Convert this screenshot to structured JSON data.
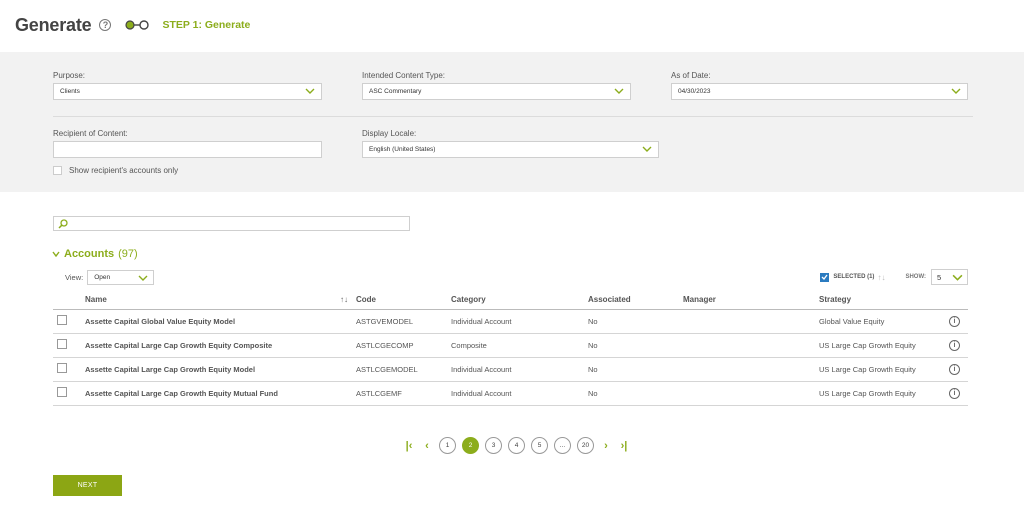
{
  "header": {
    "title": "Generate",
    "help_icon": "?",
    "step_label": "STEP 1: Generate"
  },
  "filters": {
    "purpose": {
      "label": "Purpose:",
      "value": "Clients"
    },
    "content_type": {
      "label": "Intended Content Type:",
      "value": "ASC Commentary"
    },
    "as_of_date": {
      "label": "As of Date:",
      "value": "04/30/2023"
    },
    "recipient": {
      "label": "Recipient of Content:",
      "value": ""
    },
    "locale": {
      "label": "Display Locale:",
      "value": "English (United States)"
    },
    "show_recipient_only": {
      "label": "Show recipient's accounts only",
      "checked": false
    }
  },
  "search": {
    "placeholder": ""
  },
  "accounts": {
    "title": "Accounts",
    "count": "(97)",
    "view_label": "View:",
    "view_value": "Open",
    "selected_label": "SELECTED (1)",
    "show_label": "SHOW:",
    "show_value": "5",
    "columns": {
      "name": "Name",
      "code": "Code",
      "category": "Category",
      "associated": "Associated",
      "manager": "Manager",
      "strategy": "Strategy"
    },
    "rows": [
      {
        "name": "Assette Capital Global Value Equity Model",
        "code": "ASTGVEMODEL",
        "category": "Individual Account",
        "associated": "No",
        "manager": "",
        "strategy": "Global Value Equity"
      },
      {
        "name": "Assette Capital Large Cap Growth Equity Composite",
        "code": "ASTLCGECOMP",
        "category": "Composite",
        "associated": "No",
        "manager": "",
        "strategy": "US Large Cap Growth Equity"
      },
      {
        "name": "Assette Capital Large Cap Growth Equity Model",
        "code": "ASTLCGEMODEL",
        "category": "Individual Account",
        "associated": "No",
        "manager": "",
        "strategy": "US Large Cap Growth Equity"
      },
      {
        "name": "Assette Capital Large Cap Growth Equity Mutual Fund",
        "code": "ASTLCGEMF",
        "category": "Individual Account",
        "associated": "No",
        "manager": "",
        "strategy": "US Large Cap Growth Equity"
      }
    ]
  },
  "pagination": {
    "pages": [
      "1",
      "2",
      "3",
      "4",
      "5",
      "...",
      "20"
    ],
    "current": "2"
  },
  "footer": {
    "next_label": "NEXT"
  },
  "colors": {
    "accent": "#8cad1c",
    "panel": "#f2f2f2",
    "checkbox_selected": "#2b7bc0"
  },
  "icons": {
    "help": "help-icon",
    "step": "step-icon",
    "dropdown": "chevron-down-icon",
    "search": "search-icon",
    "info": "info-icon"
  }
}
